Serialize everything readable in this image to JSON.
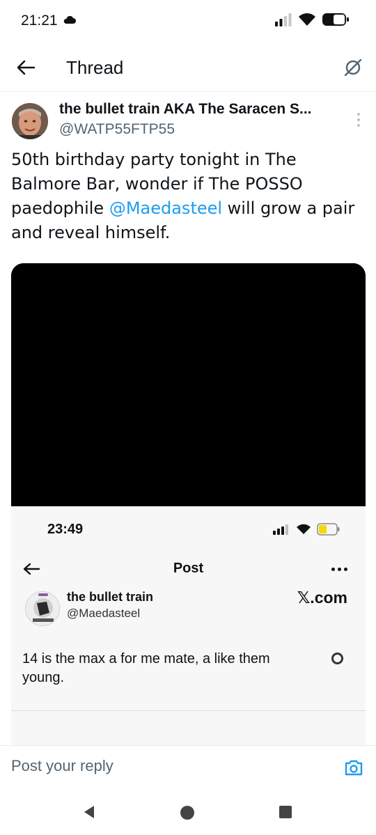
{
  "status_bar": {
    "time": "21:21",
    "icons": [
      "cloud-icon",
      "signal-icon",
      "wifi-icon",
      "battery-icon"
    ]
  },
  "header": {
    "title": "Thread",
    "back_icon": "arrow-left-icon",
    "grok_icon": "grok-icon"
  },
  "post": {
    "author_name": "the bullet train AKA The Saracen S...",
    "author_handle": "@WATP55FTP55",
    "text_before_mention": "50th birthday party tonight in The Balmore Bar, wonder if The POSSO paedophile ",
    "mention": "@Maedasteel",
    "text_after_mention": " will grow a pair  and reveal himself."
  },
  "embedded_screenshot": {
    "time": "23:49",
    "page_title": "Post",
    "author_name": "the bullet train",
    "author_handle": "@Maedasteel",
    "source_label": "𝕏.com",
    "text": "14 is the max a for me mate,  a like them young."
  },
  "reply": {
    "placeholder": "Post your reply",
    "camera_icon": "camera-icon"
  },
  "colors": {
    "accent": "#1d9bf0",
    "text": "#0f1419",
    "secondary_text": "#536471"
  }
}
